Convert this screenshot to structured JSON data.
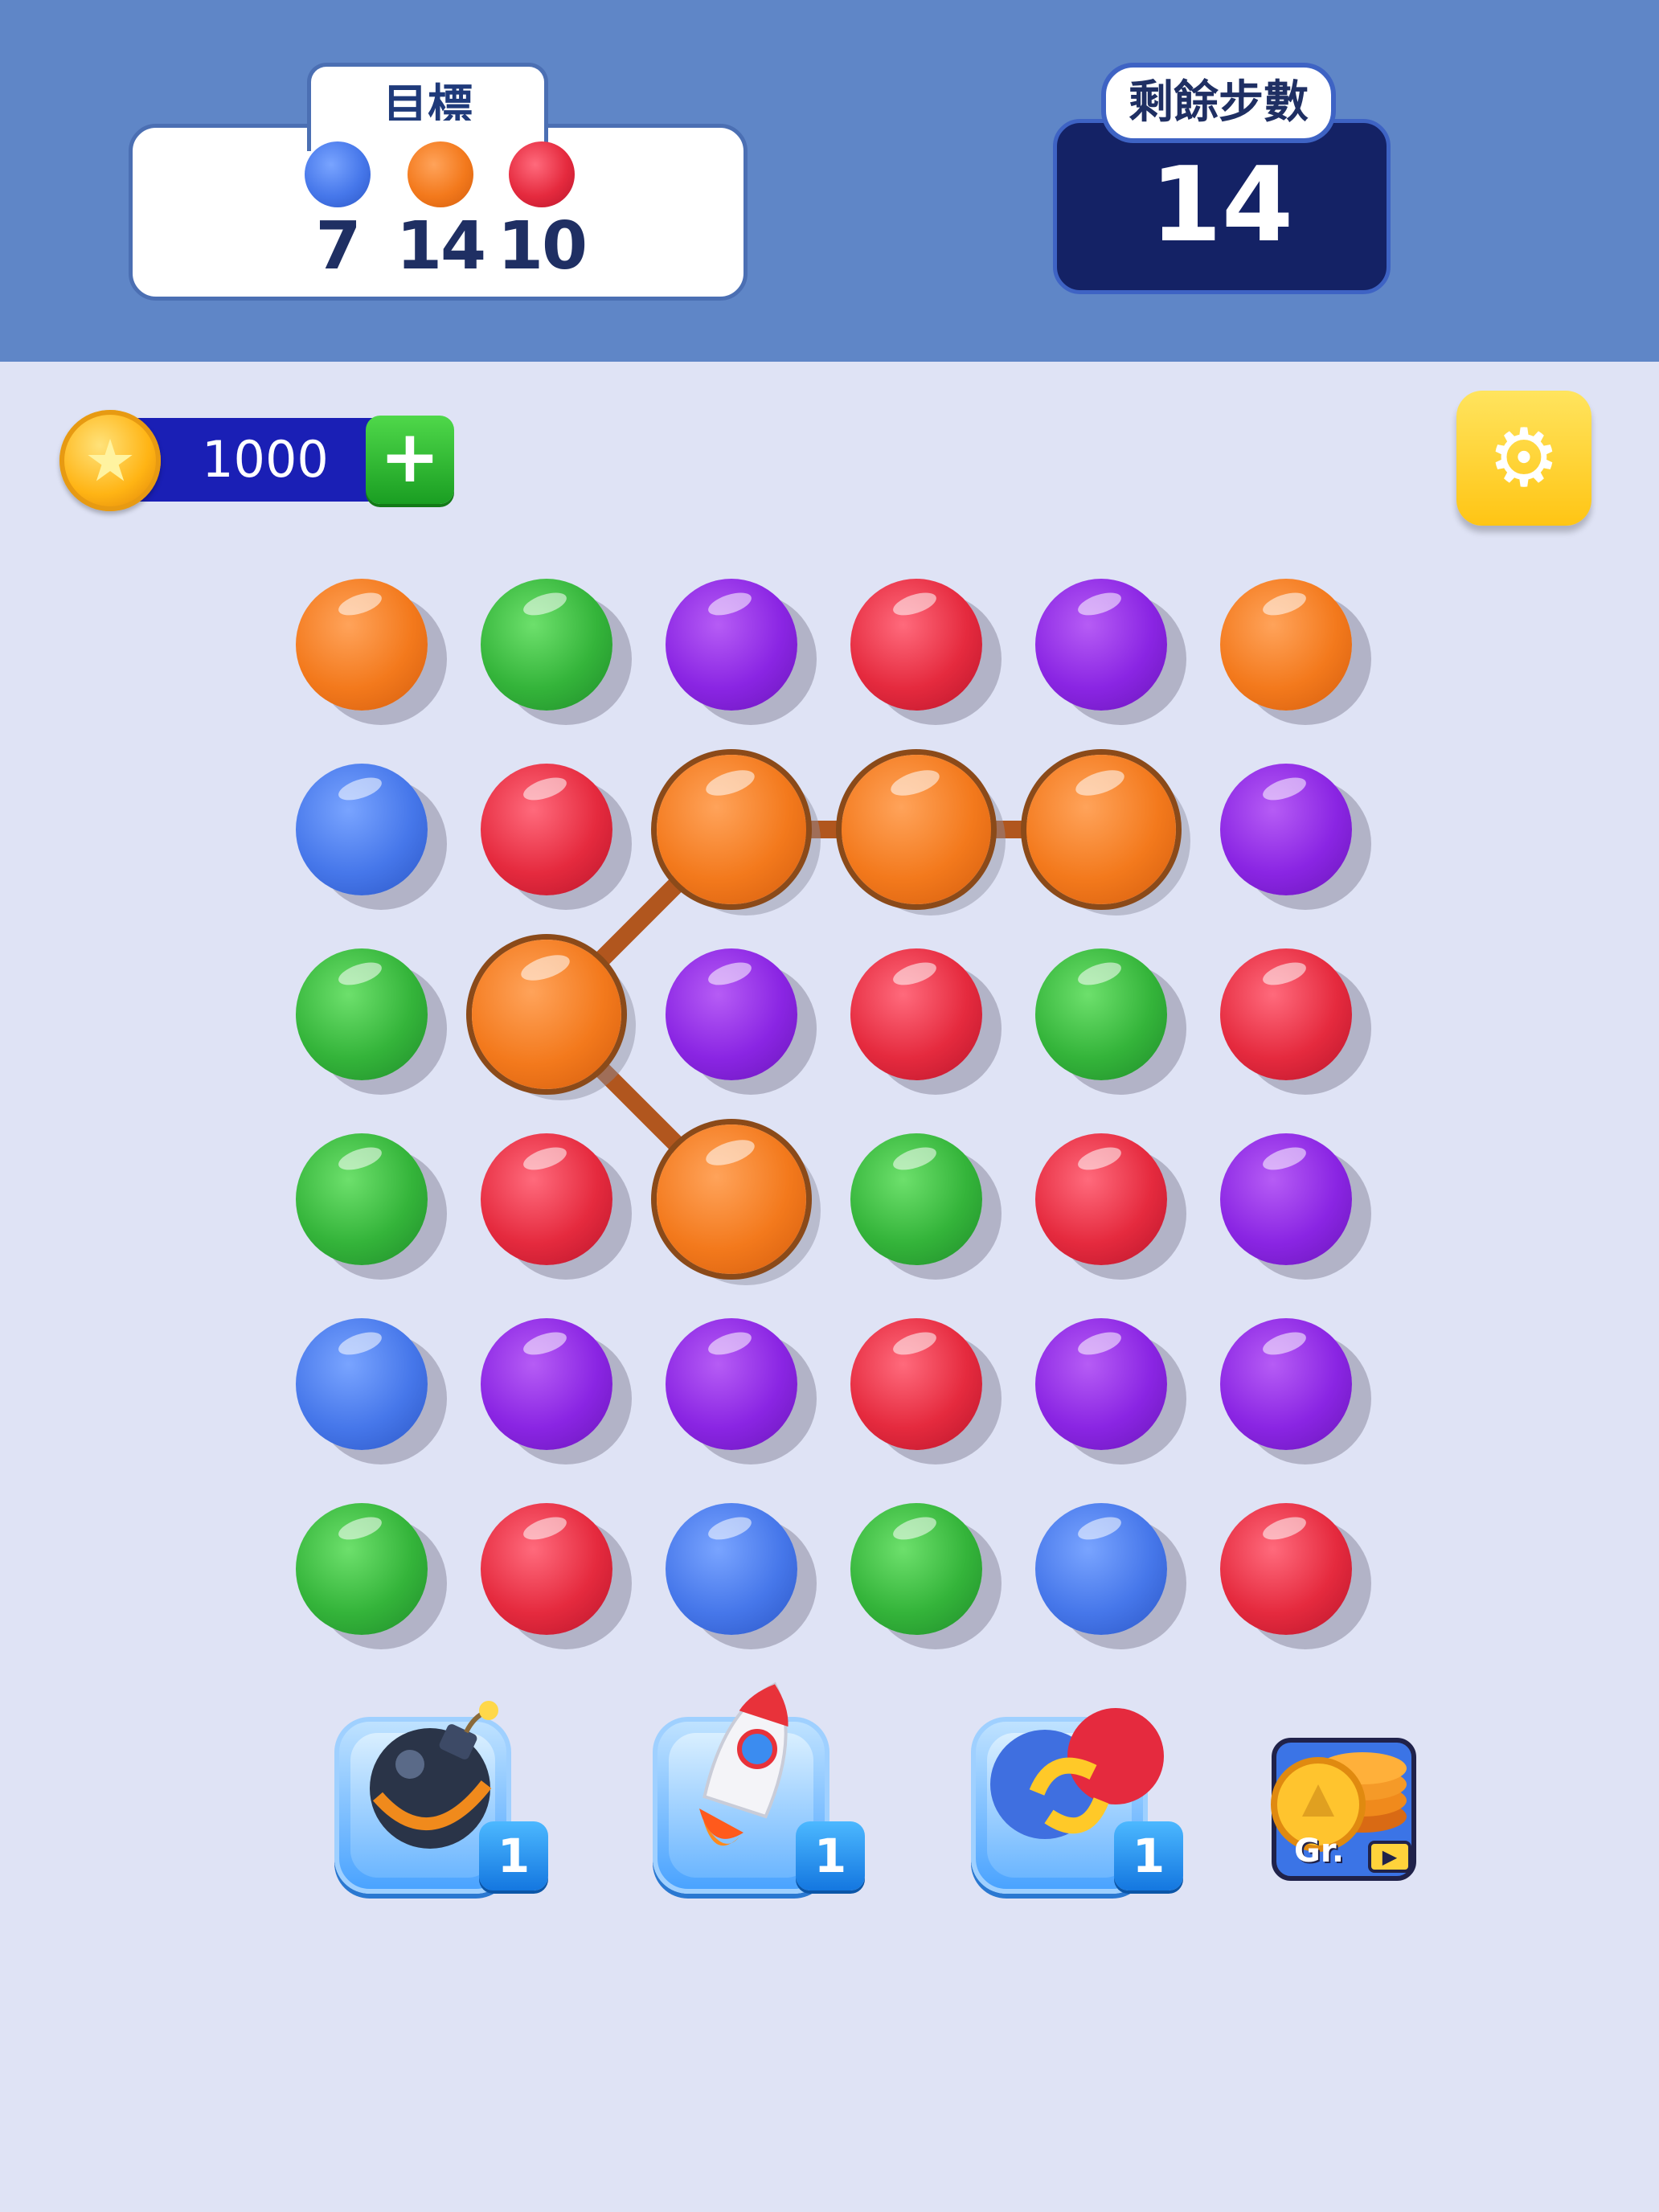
{
  "header": {
    "goal_title": "目標",
    "goals": [
      {
        "color_name": "blue",
        "color": "#4677ea",
        "count": "7"
      },
      {
        "color_name": "orange",
        "color": "#f3791c",
        "count": "14"
      },
      {
        "color_name": "red",
        "color": "#e52a3e",
        "count": "10"
      }
    ],
    "moves_title": "剩餘步數",
    "moves_value": "14"
  },
  "coins": {
    "value": "1000",
    "add_label": "+",
    "coin_icon": "star-coin-icon"
  },
  "settings": {
    "icon": "gear-icon",
    "glyph": "⚙"
  },
  "board": {
    "rows": 6,
    "cols": 6,
    "grid": [
      [
        "orange",
        "green",
        "purple",
        "red",
        "purple",
        "orange"
      ],
      [
        "blue",
        "red",
        "orange",
        "orange",
        "orange",
        "purple"
      ],
      [
        "green",
        "orange",
        "purple",
        "red",
        "green",
        "red"
      ],
      [
        "green",
        "red",
        "orange",
        "green",
        "red",
        "purple"
      ],
      [
        "blue",
        "purple",
        "purple",
        "red",
        "purple",
        "purple"
      ],
      [
        "green",
        "red",
        "blue",
        "green",
        "blue",
        "red"
      ]
    ],
    "selected_path": [
      [
        3,
        2
      ],
      [
        2,
        1
      ],
      [
        1,
        2
      ],
      [
        1,
        3
      ],
      [
        1,
        4
      ]
    ],
    "path_color": "#b1561e"
  },
  "boosters": [
    {
      "name": "bomb",
      "icon": "bomb-icon",
      "glyph": "💣",
      "count": "1"
    },
    {
      "name": "rocket",
      "icon": "rocket-icon",
      "glyph": "🚀",
      "count": "1"
    },
    {
      "name": "swap",
      "icon": "swap-colors-icon",
      "glyph": "⇄",
      "count": "1"
    }
  ],
  "video_booster": {
    "label": "Gr.",
    "icon": "coin-stack-icon",
    "play_icon": "play-video-icon",
    "play_glyph": "▶"
  }
}
